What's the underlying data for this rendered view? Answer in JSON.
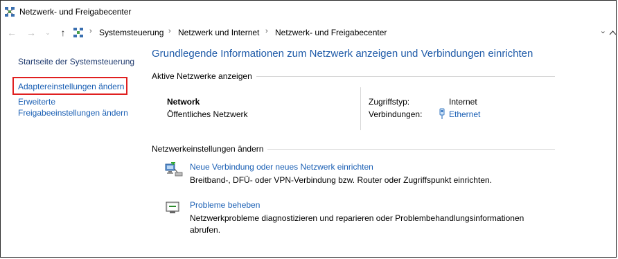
{
  "window": {
    "title": "Netzwerk- und Freigabecenter"
  },
  "address": {
    "crumbs": [
      "Systemsteuerung",
      "Netzwerk und Internet",
      "Netzwerk- und Freigabecenter"
    ]
  },
  "sidebar": {
    "home": "Startseite der Systemsteuerung",
    "adapter": "Adaptereinstellungen ändern",
    "advanced_line1": "Erweiterte",
    "advanced_line2": "Freigabeeinstellungen ändern"
  },
  "main": {
    "title": "Grundlegende Informationen zum Netzwerk anzeigen und Verbindungen einrichten",
    "active_section": "Aktive Netzwerke anzeigen",
    "network": {
      "name": "Network",
      "type": "Öffentliches Netzwerk",
      "access_label": "Zugriffstyp:",
      "access_value": "Internet",
      "connections_label": "Verbindungen:",
      "connections_value": "Ethernet"
    },
    "settings_section": "Netzwerkeinstellungen ändern",
    "tasks": [
      {
        "link": "Neue Verbindung oder neues Netzwerk einrichten",
        "desc": "Breitband-, DFÜ- oder VPN-Verbindung bzw. Router oder Zugriffspunkt einrichten."
      },
      {
        "link": "Probleme beheben",
        "desc": "Netzwerkprobleme diagnostizieren und reparieren oder Problembehandlungsinformationen abrufen."
      }
    ]
  },
  "colors": {
    "link": "#1a5fb4",
    "title": "#1e5aa8",
    "highlight": "#e02020"
  }
}
